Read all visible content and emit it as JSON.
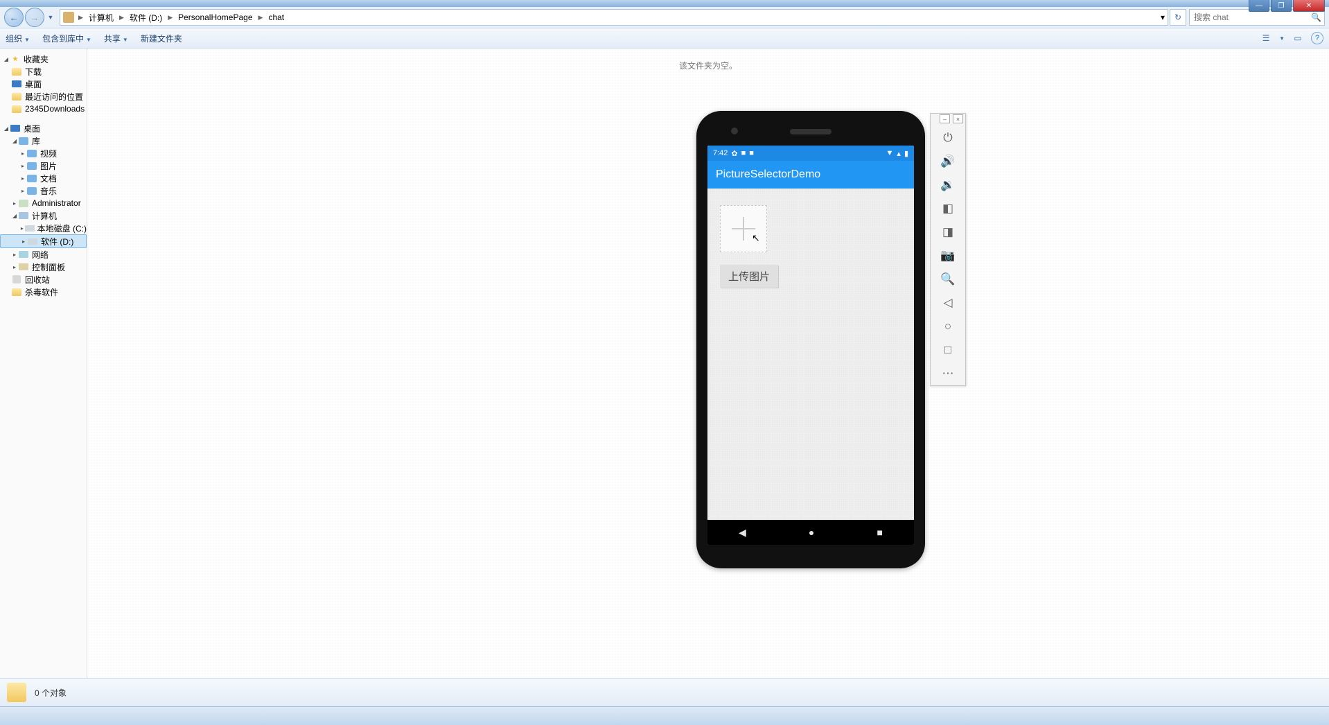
{
  "window_controls": {
    "min": "—",
    "max": "❐",
    "close": "✕"
  },
  "breadcrumb": {
    "icon": "📁",
    "items": [
      "计算机",
      "软件 (D:)",
      "PersonalHomePage",
      "chat"
    ],
    "dd": "▾",
    "refresh": "↻"
  },
  "search": {
    "placeholder": "搜索 chat",
    "icon": "🔍"
  },
  "toolbar": {
    "organize": "组织",
    "include": "包含到库中",
    "share": "共享",
    "newfolder": "新建文件夹",
    "view": "☰",
    "preview": "▭",
    "help": "?"
  },
  "sidebar": {
    "favorites": {
      "label": "收藏夹",
      "items": [
        {
          "label": "下载",
          "icon": "folder"
        },
        {
          "label": "桌面",
          "icon": "desktop"
        },
        {
          "label": "最近访问的位置",
          "icon": "folder"
        },
        {
          "label": "2345Downloads",
          "icon": "folder"
        }
      ]
    },
    "desktop": {
      "label": "桌面",
      "children": [
        {
          "label": "库",
          "icon": "lib",
          "children": [
            {
              "label": "视频",
              "icon": "lib"
            },
            {
              "label": "图片",
              "icon": "lib"
            },
            {
              "label": "文档",
              "icon": "lib"
            },
            {
              "label": "音乐",
              "icon": "lib"
            }
          ]
        },
        {
          "label": "Administrator",
          "icon": "user"
        },
        {
          "label": "计算机",
          "icon": "computer",
          "children": [
            {
              "label": "本地磁盘 (C:)",
              "icon": "drive"
            },
            {
              "label": "软件 (D:)",
              "icon": "drive",
              "selected": true
            }
          ]
        },
        {
          "label": "网络",
          "icon": "net"
        },
        {
          "label": "控制面板",
          "icon": "panel"
        },
        {
          "label": "回收站",
          "icon": "bin"
        },
        {
          "label": "杀毒软件",
          "icon": "folder"
        }
      ]
    }
  },
  "content": {
    "empty": "该文件夹为空。"
  },
  "phone": {
    "time": "7:42",
    "status_icons": {
      "gear": "✿",
      "sq1": "■",
      "sq2": "■",
      "wifi": "▼",
      "signal": "▴",
      "batt": "▮"
    },
    "app_title": "PictureSelectorDemo",
    "upload_btn": "上传图片",
    "nav": {
      "back": "◀",
      "home": "●",
      "recent": "■"
    }
  },
  "emu_toolbar": {
    "head": {
      "min": "–",
      "close": "×"
    },
    "buttons": [
      {
        "name": "power-icon",
        "glyph": "⏻"
      },
      {
        "name": "volume-up-icon",
        "glyph": "🔊"
      },
      {
        "name": "volume-down-icon",
        "glyph": "🔉"
      },
      {
        "name": "rotate-left-icon",
        "glyph": "◧"
      },
      {
        "name": "rotate-right-icon",
        "glyph": "◨"
      },
      {
        "name": "camera-icon",
        "glyph": "📷"
      },
      {
        "name": "zoom-icon",
        "glyph": "🔍"
      },
      {
        "name": "back-icon",
        "glyph": "◁"
      },
      {
        "name": "home-icon",
        "glyph": "○"
      },
      {
        "name": "overview-icon",
        "glyph": "□"
      },
      {
        "name": "more-icon",
        "glyph": "⋯"
      }
    ]
  },
  "statusbar": {
    "text": "0 个对象"
  }
}
